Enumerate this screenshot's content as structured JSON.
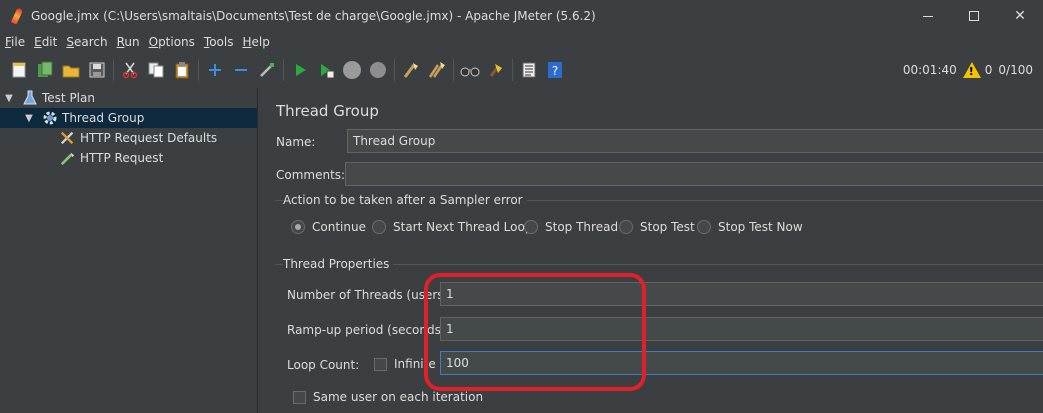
{
  "window": {
    "title": "Google.jmx (C:\\Users\\smaltais\\Documents\\Test de charge\\Google.jmx) - Apache JMeter (5.6.2)",
    "minimize": "–",
    "maximize": "☐",
    "close": "✕"
  },
  "menu": {
    "items": [
      "File",
      "Edit",
      "Search",
      "Run",
      "Options",
      "Tools",
      "Help"
    ]
  },
  "toolbar": {
    "timer": "00:01:40",
    "warning_count": "0",
    "threads": "0/100",
    "icons": [
      "new-icon",
      "templates-icon",
      "open-icon",
      "save-icon",
      "cut-icon",
      "copy-icon",
      "paste-icon",
      "expand-icon",
      "collapse-icon",
      "toggle-icon",
      "start-icon",
      "start-no-pause-icon",
      "stop-icon",
      "shutdown-icon",
      "clear-icon",
      "clear-all-icon",
      "search-icon",
      "reset-search-icon",
      "function-helper-icon",
      "help-icon"
    ]
  },
  "tree": {
    "items": [
      {
        "label": "Test Plan",
        "icon": "test-plan-icon",
        "expanded": true
      },
      {
        "label": "Thread Group",
        "icon": "gear-icon",
        "expanded": true,
        "selected": true
      },
      {
        "label": "HTTP Request Defaults",
        "icon": "wrench-icon"
      },
      {
        "label": "HTTP Request",
        "icon": "pipette-icon"
      }
    ]
  },
  "panel": {
    "title": "Thread Group",
    "name_label": "Name:",
    "name_value": "Thread Group",
    "comments_label": "Comments:",
    "comments_value": "",
    "sampler_error": {
      "title": "Action to be taken after a Sampler error",
      "options": [
        "Continue",
        "Start Next Thread Loop",
        "Stop Thread",
        "Stop Test",
        "Stop Test Now"
      ],
      "selected": "Continue"
    },
    "thread_props": {
      "title": "Thread Properties",
      "threads_label": "Number of Threads (users",
      "threads_value": "1",
      "rampup_label": "Ramp-up period (seconds",
      "rampup_value": "1",
      "loop_label": "Loop Count:",
      "infinite_label": "Infinite",
      "loop_value": "100",
      "same_user_label": "Same user on each iteration"
    }
  },
  "colors": {
    "background": "#3c3f41",
    "selection": "#0d293e",
    "highlight": "#e0202a",
    "focus": "#3d7fc4"
  }
}
